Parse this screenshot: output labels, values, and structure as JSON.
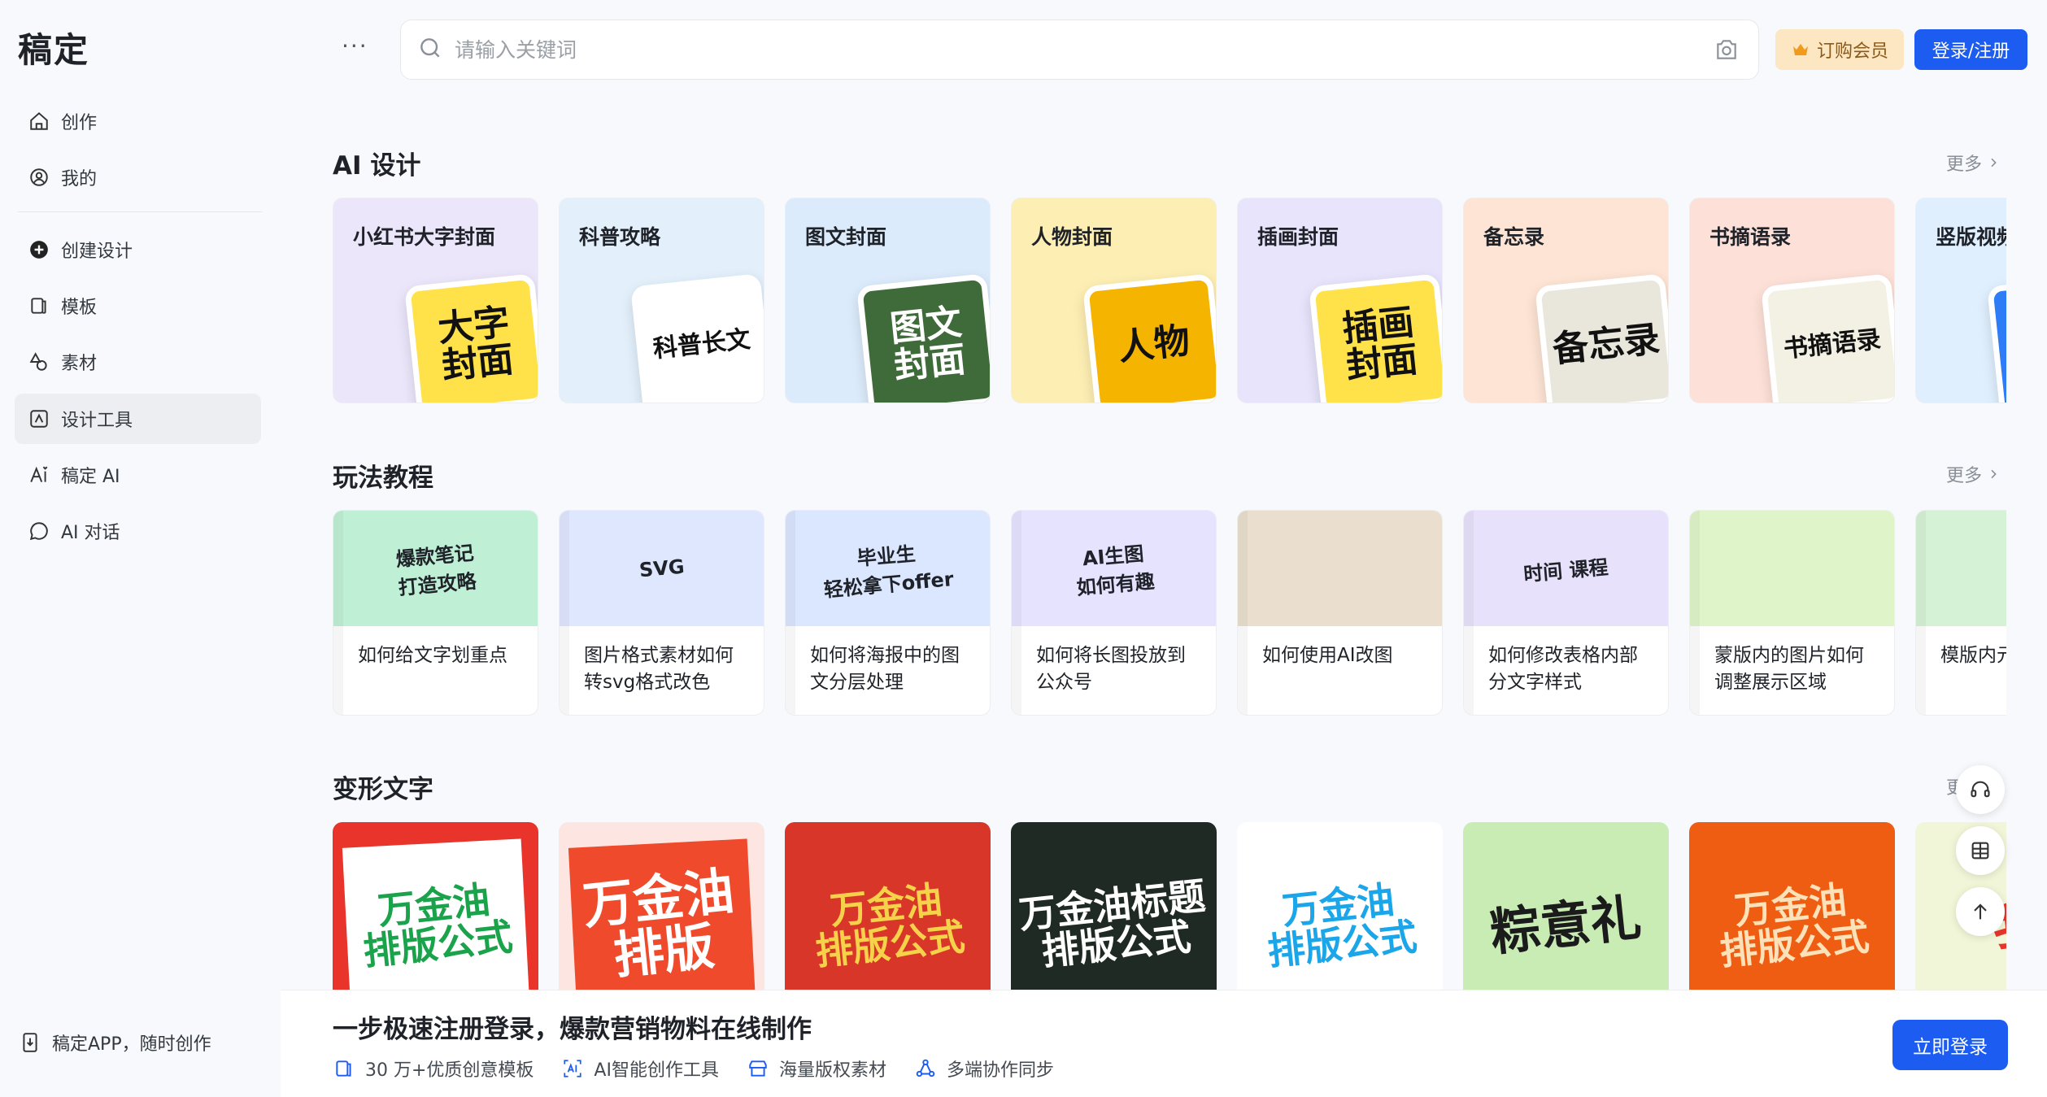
{
  "app": {
    "logo": "稿定"
  },
  "sidebar": {
    "items": [
      {
        "label": "创作",
        "icon": "home-icon"
      },
      {
        "label": "我的",
        "icon": "user-icon"
      },
      {
        "label": "创建设计",
        "icon": "plus-circle-icon"
      },
      {
        "label": "模板",
        "icon": "template-icon"
      },
      {
        "label": "素材",
        "icon": "shapes-icon"
      },
      {
        "label": "设计工具",
        "icon": "tools-icon",
        "active": true
      },
      {
        "label": "稿定 AI",
        "icon": "ai-icon"
      },
      {
        "label": "AI 对话",
        "icon": "chat-icon"
      }
    ],
    "app_link": "稿定APP，随时创作"
  },
  "header": {
    "more": "···",
    "search_placeholder": "请输入关键词",
    "vip_label": "订购会员",
    "login_label": "登录/注册"
  },
  "sections": {
    "ai_design": {
      "title": "AI 设计",
      "more": "更多",
      "cards": [
        {
          "label": "小红书大字封面",
          "art": "大字\n封面",
          "bg": "#ece6fb",
          "art_bg": "#ffe14a"
        },
        {
          "label": "科普攻略",
          "art": "科普长文",
          "bg": "#e3f0fb",
          "art_bg": "#ffffff"
        },
        {
          "label": "图文封面",
          "art": "图文\n封面",
          "bg": "#dcebfb",
          "art_bg": "#3f6b3a"
        },
        {
          "label": "人物封面",
          "art": "人物",
          "bg": "#fdeeb3",
          "art_bg": "#f4b400"
        },
        {
          "label": "插画封面",
          "art": "插画\n封面",
          "bg": "#e7e4fb",
          "art_bg": "#ffe14a"
        },
        {
          "label": "备忘录",
          "art": "备忘录",
          "bg": "#fde4d4",
          "art_bg": "#e9e7dc"
        },
        {
          "label": "书摘语录",
          "art": "书摘语录",
          "bg": "#fde1d8",
          "art_bg": "#f3f1e4"
        },
        {
          "label": "竖版视频",
          "art": "",
          "bg": "#dfeffd",
          "art_bg": "#2e7cf6"
        }
      ]
    },
    "tutorials": {
      "title": "玩法教程",
      "more": "更多",
      "cards": [
        {
          "caption": "如何给文字划重点",
          "thumb_text": "爆款笔记\n打造攻略",
          "thumb_bg": "#bff0d6"
        },
        {
          "caption": "图片格式素材如何转svg格式改色",
          "thumb_text": "SVG",
          "thumb_bg": "#dfe7ff"
        },
        {
          "caption": "如何将海报中的图文分层处理",
          "thumb_text": "毕业生\n轻松拿下offer",
          "thumb_bg": "#dbe6ff"
        },
        {
          "caption": "如何将长图投放到公众号",
          "thumb_text": "AI生图\n如何有趣",
          "thumb_bg": "#e6e3ff"
        },
        {
          "caption": "如何使用AI改图",
          "thumb_text": "",
          "thumb_bg": "#eadfcf"
        },
        {
          "caption": "如何修改表格内部分文字样式",
          "thumb_text": "时间 课程",
          "thumb_bg": "#e8e1fb"
        },
        {
          "caption": "蒙版内的图片如何调整展示区域",
          "thumb_text": "",
          "thumb_bg": "#dff5c9"
        },
        {
          "caption": "模版内元找相似",
          "thumb_text": "",
          "thumb_bg": "#d6f2d6"
        }
      ]
    },
    "text_effects": {
      "title": "变形文字",
      "more": "更多",
      "cards": [
        {
          "text": "万金油\n排版公式",
          "bg": "#e8342b",
          "color": "#1aa34a",
          "paper": "#ffffff"
        },
        {
          "text": "万金油\n排版",
          "bg": "#fde6e1",
          "color": "#ffffff",
          "paper": "#f04a2d"
        },
        {
          "text": "万金油\n排版公式",
          "bg": "#d9362a",
          "color": "#f6d24a",
          "paper": "#d9362a"
        },
        {
          "text": "万金油标题\n排版公式",
          "bg": "#1f2a24",
          "color": "#ffffff",
          "paper": "#1f2a24"
        },
        {
          "text": "万金油\n排版公式",
          "bg": "#ffffff",
          "color": "#1aa6e8",
          "paper": "#ffffff"
        },
        {
          "text": "粽意礼",
          "bg": "#c9ecb5",
          "color": "#1b1b1b",
          "paper": "#c9ecb5"
        },
        {
          "text": "万金油\n排版公式",
          "bg": "#ef5d13",
          "color": "#fde1b8",
          "paper": "#ef5d13"
        },
        {
          "text": "我",
          "bg": "#f2f6d8",
          "color": "#e8342b",
          "paper": "#f2f6d8"
        }
      ]
    }
  },
  "banner": {
    "title": "一步极速注册登录，爆款营销物料在线制作",
    "features": [
      {
        "label": "30 万+优质创意模板",
        "icon": "template-icon"
      },
      {
        "label": "AI智能创作工具",
        "icon": "ai-box-icon"
      },
      {
        "label": "海量版权素材",
        "icon": "store-icon"
      },
      {
        "label": "多端协作同步",
        "icon": "sync-icon"
      }
    ],
    "cta": "立即登录"
  },
  "colors": {
    "primary": "#1d5cf0",
    "vip_bg": "#fde6c2",
    "vip_text": "#8a5a1a"
  }
}
